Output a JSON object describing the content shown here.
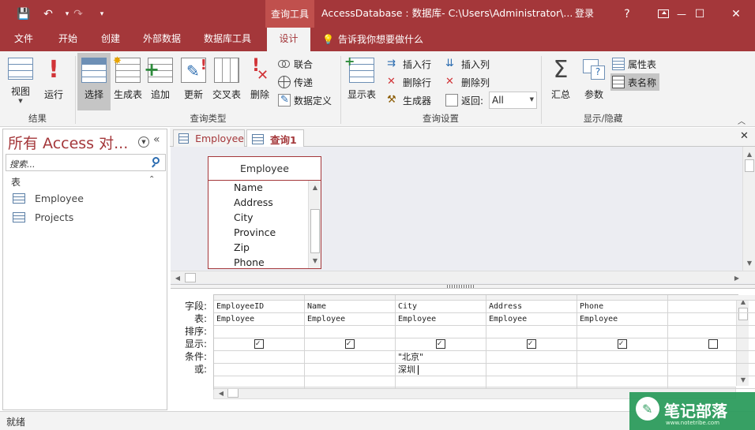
{
  "titlebar": {
    "context_tab": "查询工具",
    "window_title": "AccessDatabase : 数据库- C:\\Users\\Administrator\\...",
    "login": "登录",
    "help": "?",
    "minimize": "—",
    "maximize": "☐",
    "close": "✕",
    "save_glyph": "💾",
    "undo_glyph": "↶",
    "redo_glyph": "↷",
    "customize_glyph": "▾"
  },
  "ribbon_tabs": [
    "文件",
    "开始",
    "创建",
    "外部数据",
    "数据库工具",
    "设计"
  ],
  "tell_me": "告诉我你想要做什么",
  "ribbon": {
    "results": {
      "label": "结果",
      "view": "视图",
      "run": "运行"
    },
    "query_type": {
      "label": "查询类型",
      "select": "选择",
      "make_table": "生成表",
      "append": "追加",
      "update": "更新",
      "crosstab": "交叉表",
      "delete": "删除",
      "union": "联合",
      "pass_through": "传递",
      "data_definition": "数据定义"
    },
    "query_setup": {
      "label": "查询设置",
      "show_table": "显示表",
      "insert_rows": "插入行",
      "delete_rows": "删除行",
      "builder": "生成器",
      "insert_columns": "插入列",
      "delete_columns": "删除列",
      "return": "返回:",
      "return_value": "All"
    },
    "show_hide": {
      "label": "显示/隐藏",
      "totals": "汇总",
      "parameters": "参数",
      "property_sheet": "属性表",
      "table_names": "表名称"
    }
  },
  "nav_pane": {
    "title": "所有 Access 对...",
    "search_placeholder": "搜索...",
    "section": "表",
    "items": [
      "Employee",
      "Projects"
    ]
  },
  "doc_tabs": [
    "Employee",
    "查询1"
  ],
  "table_box": {
    "name": "Employee",
    "fields": [
      "Name",
      "Address",
      "City",
      "Province",
      "Zip",
      "Phone"
    ]
  },
  "grid": {
    "row_labels": [
      "字段:",
      "表:",
      "排序:",
      "显示:",
      "条件:",
      "或:"
    ],
    "columns": [
      {
        "field": "EmployeeID",
        "table": "Employee",
        "show": true,
        "criteria": "",
        "or": ""
      },
      {
        "field": "Name",
        "table": "Employee",
        "show": true,
        "criteria": "",
        "or": ""
      },
      {
        "field": "City",
        "table": "Employee",
        "show": true,
        "criteria": "\"北京\"",
        "or": "深圳"
      },
      {
        "field": "Address",
        "table": "Employee",
        "show": true,
        "criteria": "",
        "or": ""
      },
      {
        "field": "Phone",
        "table": "Employee",
        "show": true,
        "criteria": "",
        "or": ""
      },
      {
        "field": "",
        "table": "",
        "show": false,
        "criteria": "",
        "or": ""
      }
    ]
  },
  "status": "就绪",
  "watermark": {
    "title": "笔记部落",
    "url": "www.notetribe.com"
  },
  "colors": {
    "accent": "#a4373a",
    "ribbon_bg": "#f3f3f3",
    "design_bg": "#ecedf2"
  }
}
